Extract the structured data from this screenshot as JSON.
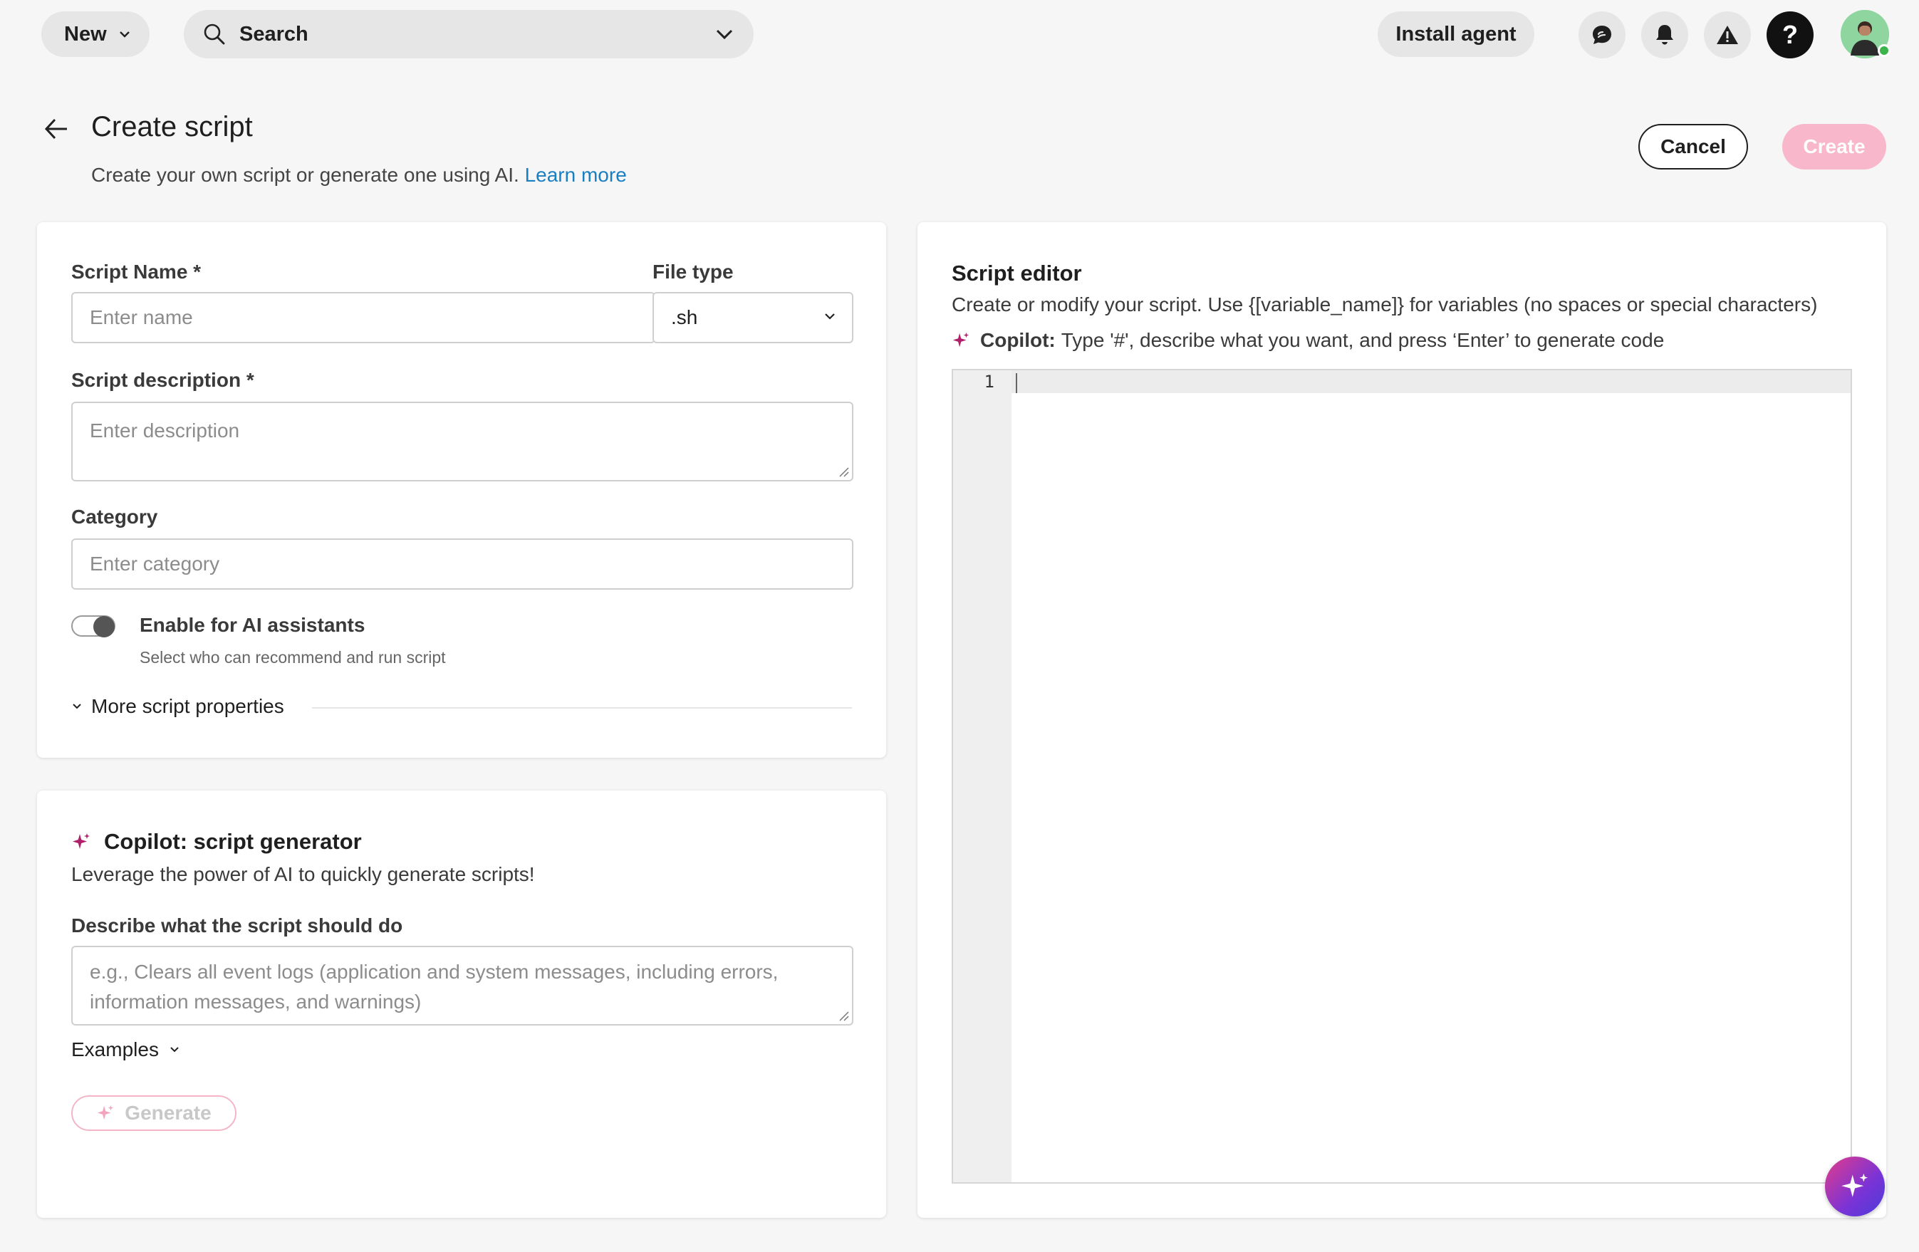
{
  "topbar": {
    "new_label": "New",
    "search_label": "Search",
    "install_label": "Install agent",
    "help_label": "?"
  },
  "header": {
    "title": "Create script",
    "subtitle": "Create your own script or generate one using AI.",
    "learn_more": "Learn more",
    "cancel_label": "Cancel",
    "create_label": "Create"
  },
  "details": {
    "script_name_label": "Script Name *",
    "script_name_placeholder": "Enter name",
    "file_type_label": "File type",
    "file_type_value": ".sh",
    "description_label": "Script description *",
    "description_placeholder": "Enter description",
    "category_label": "Category",
    "category_placeholder": "Enter category",
    "ai_toggle_label": "Enable for AI assistants",
    "ai_toggle_sub": "Select who can recommend and run script",
    "ai_toggle_on": false,
    "more_props_label": "More script properties"
  },
  "copilot": {
    "title": "Copilot: script generator",
    "subtitle": "Leverage the power of AI to quickly generate scripts!",
    "prompt_label": "Describe what the script should do",
    "prompt_placeholder": "e.g., Clears all event logs (application and system messages, including errors, information messages, and warnings)",
    "examples_label": "Examples",
    "generate_label": "Generate"
  },
  "editor": {
    "title": "Script editor",
    "subtitle": "Create or modify your script. Use {[variable_name]} for variables (no spaces or special characters)",
    "copilot_prefix": "Copilot:",
    "copilot_hint": "Type '#', describe what you want, and press ‘Enter’ to generate code",
    "line_number": "1"
  },
  "colors": {
    "accent_pink": "#f8b7cb",
    "link_blue": "#1a7fc1",
    "sparkle": "#b0206a"
  }
}
